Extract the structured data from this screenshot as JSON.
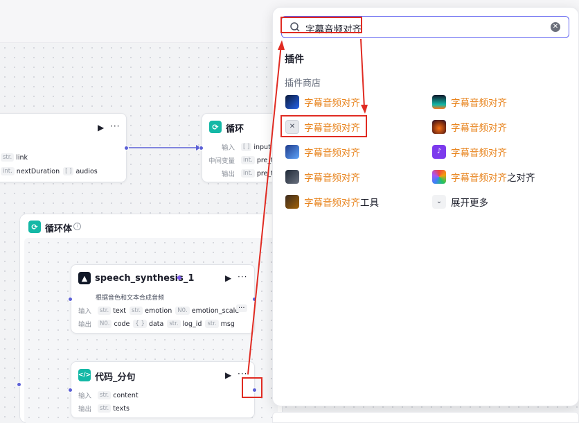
{
  "nodes": {
    "left_partial": {
      "row1_tag": "str.",
      "row1_value": "link",
      "row2_tag1": "int.",
      "row2_value1": "nextDuration",
      "row2_tag2": "[ ]",
      "row2_value2": "audios"
    },
    "loop": {
      "title": "循环",
      "input_label": "输入",
      "input_tag": "[ ]",
      "input_value": "input",
      "mid_label": "中间变量",
      "mid_tag": "int.",
      "mid_value": "pre_time",
      "output_label": "输出",
      "output_tag": "int.",
      "output_value": "pre_time"
    },
    "loop_body": {
      "title": "循环体",
      "info": "i"
    },
    "speech": {
      "title": "speech_synthesis_1",
      "description": "根据音色和文本合成音频",
      "input_label": "输入",
      "inputs": [
        {
          "tag": "str.",
          "name": "text"
        },
        {
          "tag": "str.",
          "name": "emotion"
        },
        {
          "tag": "N0.",
          "name": "emotion_scale"
        }
      ],
      "output_label": "输出",
      "outputs": [
        {
          "tag": "N0.",
          "name": "code"
        },
        {
          "tag": "{ }",
          "name": "data"
        },
        {
          "tag": "str.",
          "name": "log_id"
        },
        {
          "tag": "str.",
          "name": "msg"
        }
      ],
      "more": "···"
    },
    "code": {
      "title": "代码_分句",
      "input_label": "输入",
      "input_tag": "str.",
      "input_value": "content",
      "output_label": "输出",
      "output_tag": "str.",
      "output_value": "texts"
    }
  },
  "panel": {
    "search_value": "字幕音频对齐",
    "section_title": "插件",
    "section_sub": "插件商店",
    "items_left": [
      {
        "name": "字幕音频对齐",
        "suffix": "",
        "icon": "plugin-icon-blue-note"
      },
      {
        "name": "字幕音频对齐",
        "suffix": "",
        "icon": "plugin-icon-gray-tool"
      },
      {
        "name": "字幕音频对齐",
        "suffix": "",
        "icon": "plugin-icon-blue-anime"
      },
      {
        "name": "字幕音频对齐",
        "suffix": "",
        "icon": "plugin-icon-dark-portrait"
      },
      {
        "name": "字幕音频对齐",
        "suffix": "工具",
        "icon": "plugin-icon-brown-portrait"
      }
    ],
    "items_right": [
      {
        "name": "字幕音频对齐",
        "suffix": "",
        "icon": "plugin-icon-teal-wave"
      },
      {
        "name": "字幕音频对齐",
        "suffix": "",
        "icon": "plugin-icon-sunset"
      },
      {
        "name": "字幕音频对齐",
        "suffix": "",
        "icon": "plugin-icon-purple-audio"
      },
      {
        "name": "字幕音频对齐",
        "suffix": "之对齐",
        "icon": "plugin-icon-colorful-music"
      }
    ],
    "expand_more": "展开更多"
  },
  "controls": {
    "run": "▶",
    "more": "···"
  },
  "colors": {
    "accent": "#6366f1",
    "highlight": "#e8841e",
    "annotation": "#e02b22",
    "edge": "#5b5fd6"
  }
}
